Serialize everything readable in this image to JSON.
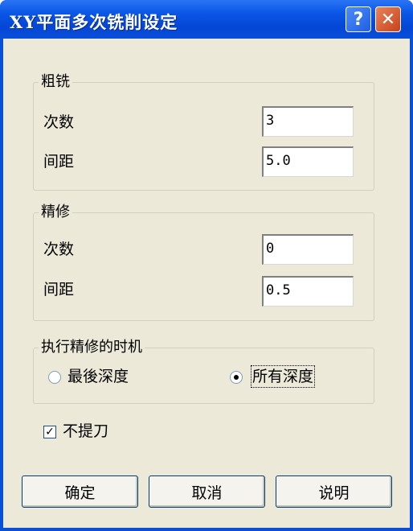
{
  "window": {
    "title": "XY平面多次铣削设定"
  },
  "titlebar_buttons": {
    "help": "?",
    "close": "✕"
  },
  "rough": {
    "legend": "粗铣",
    "count_label": "次数",
    "count_value": "3",
    "spacing_label": "间距",
    "spacing_value": "5.0"
  },
  "finish": {
    "legend": "精修",
    "count_label": "次数",
    "count_value": "0",
    "spacing_label": "间距",
    "spacing_value": "0.5"
  },
  "timing": {
    "legend": "执行精修的时机",
    "options": [
      "最後深度",
      "所有深度"
    ],
    "selected": "所有深度"
  },
  "no_lift": {
    "label": "不提刀",
    "checked": true,
    "mark": "✓"
  },
  "buttons": {
    "ok": "确定",
    "cancel": "取消",
    "help": "说明"
  }
}
